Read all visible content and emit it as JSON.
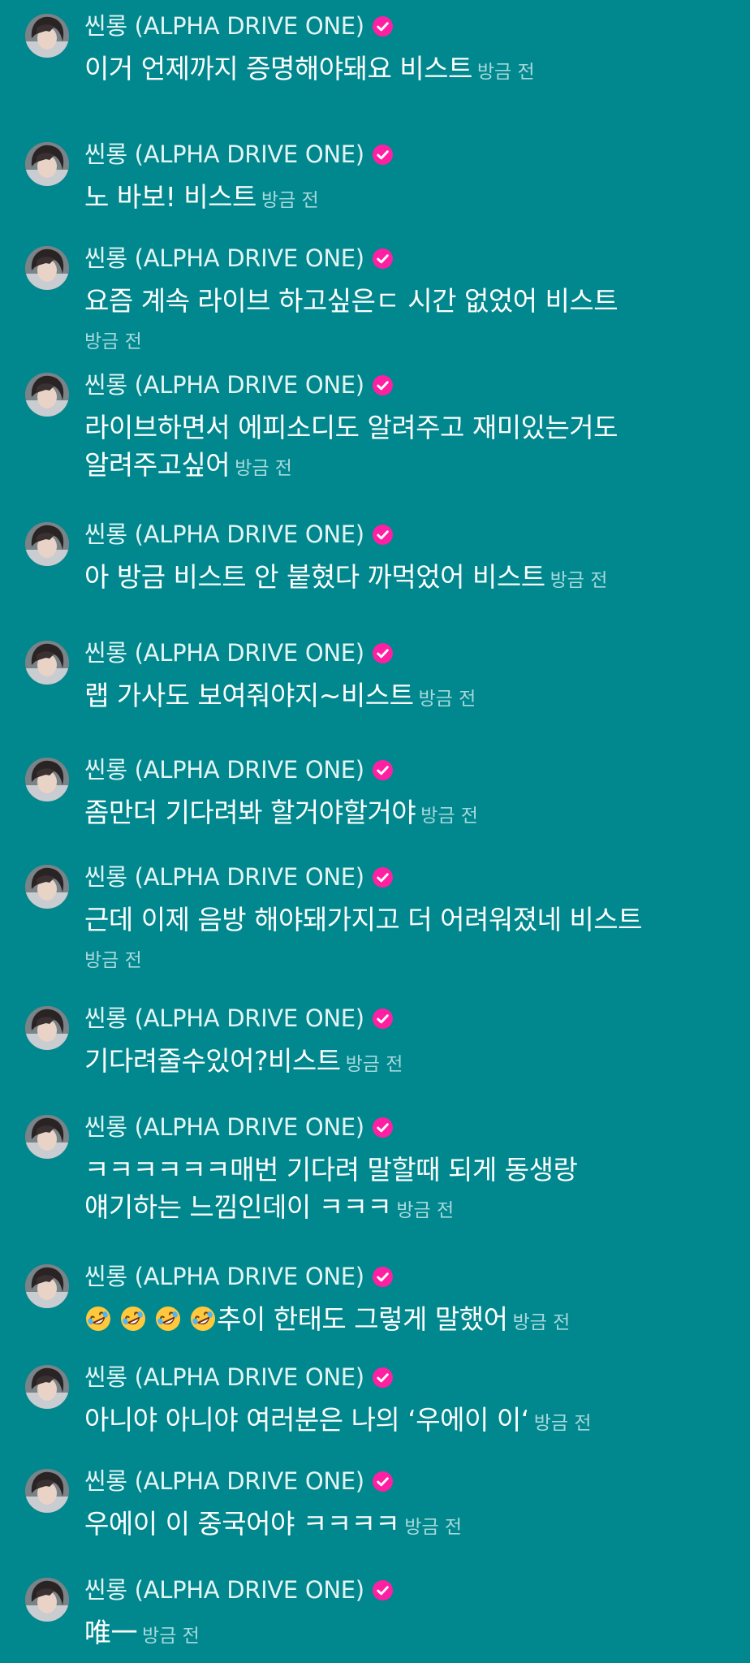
{
  "username": "씬롱 (ALPHA DRIVE ONE)",
  "timestamp": "방금 전",
  "badge_color": "#ff1fa3",
  "background_color": "#00888e",
  "messages": [
    {
      "lines": [
        "이거 언제까지 증명해야돼요 비스트"
      ],
      "time_inline": true
    },
    {
      "lines": [
        "노 바보! 비스트"
      ],
      "time_inline": true
    },
    {
      "lines": [
        "요즘 계속 라이브 하고싶은ㄷ 시간 없었어 비스트"
      ],
      "time_inline": false
    },
    {
      "lines": [
        "라이브하면서 에피소디도 알려주고 재미있는거도",
        "알려주고싶어"
      ],
      "time_inline": true
    },
    {
      "lines": [
        "아 방금 비스트 안 붙혔다 까먹었어 비스트"
      ],
      "time_inline": true
    },
    {
      "lines": [
        "랩 가사도 보여줘야지~비스트"
      ],
      "time_inline": true
    },
    {
      "lines": [
        "좀만더 기다려봐 할거야할거야"
      ],
      "time_inline": true
    },
    {
      "lines": [
        "근데 이제 음방 해야돼가지고 더 어려워졌네 비스트"
      ],
      "time_inline": false
    },
    {
      "lines": [
        "기다려줄수있어?비스트"
      ],
      "time_inline": true
    },
    {
      "lines": [
        "ㅋㅋㅋㅋㅋㅋ매번 기다려 말할때 되게 동생랑",
        "얘기하는 느낌인데이 ㅋㅋㅋ"
      ],
      "time_inline": true
    },
    {
      "lines": [
        "추이 한태도 그렇게 말했어"
      ],
      "time_inline": true,
      "emoji": "rolling-on-floor-laughing",
      "emoji_count": 4
    },
    {
      "lines": [
        "아니야 아니야 여러분은 나의 ‘우에이 이‘"
      ],
      "time_inline": true
    },
    {
      "lines": [
        "우에이 이 중국어야 ㅋㅋㅋㅋ"
      ],
      "time_inline": true
    },
    {
      "lines": [
        "唯一"
      ],
      "time_inline": true
    }
  ]
}
